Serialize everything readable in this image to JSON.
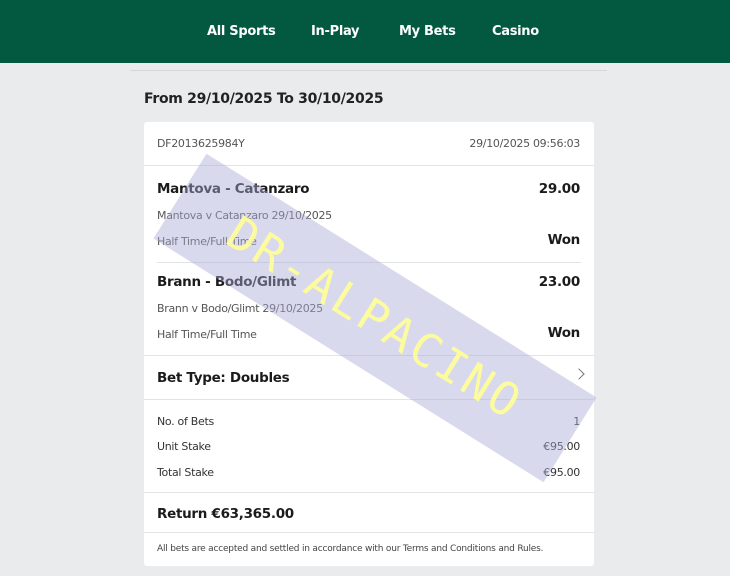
{
  "nav": {
    "items": [
      "All Sports",
      "In-Play",
      "My Bets",
      "Casino"
    ]
  },
  "date_range": "From 29/10/2025 To 30/10/2025",
  "bet": {
    "id": "DF2013625984Y",
    "datetime": "29/10/2025 09:56:03",
    "selections": [
      {
        "match": "Mantova - Catanzaro",
        "odds": "29.00",
        "event": "Mantova v Catanzaro 29/10/2025",
        "market": "Half Time/Full Time",
        "result": "Won"
      },
      {
        "match": "Brann - Bodo/Glimt",
        "odds": "23.00",
        "event": "Brann v Bodo/Glimt 29/10/2025",
        "market": "Half Time/Full Time",
        "result": "Won"
      }
    ],
    "bet_type": "Bet Type: Doubles",
    "num_bets_label": "No. of Bets",
    "num_bets": "1",
    "unit_stake_label": "Unit Stake",
    "unit_stake": "€95.00",
    "total_stake_label": "Total Stake",
    "total_stake": "€95.00",
    "return": "Return €63,365.00",
    "footer": "All bets are accepted and settled in accordance with our Terms and Conditions and Rules."
  },
  "watermark": "DR-ALPACINO"
}
